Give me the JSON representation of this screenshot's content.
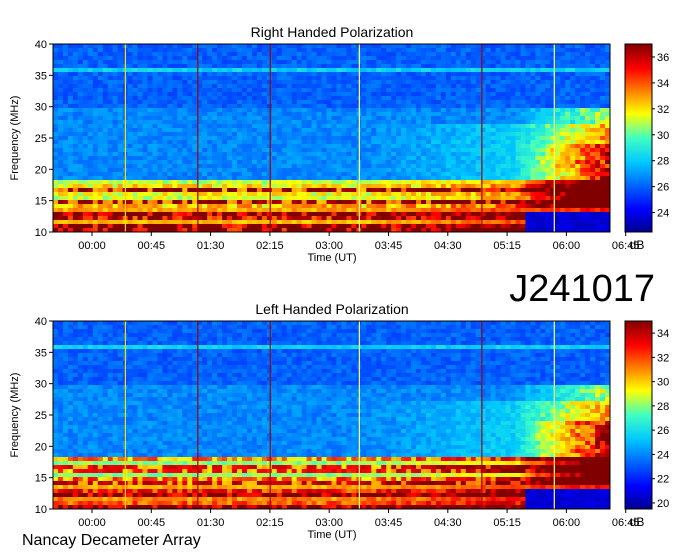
{
  "title_id": "J241017",
  "footer": "Nancay Decameter Array",
  "chart_data": [
    {
      "type": "heatmap",
      "title": "Right Handed Polarization",
      "xlabel": "Time (UT)",
      "ylabel": "Frequency (MHz)",
      "x_tick_labels": [
        "00:00",
        "00:45",
        "01:30",
        "02:15",
        "03:00",
        "03:45",
        "04:30",
        "05:15",
        "06:00",
        "06:45"
      ],
      "y_tick_labels": [
        "10",
        "15",
        "20",
        "25",
        "30",
        "35",
        "40"
      ],
      "ylim": [
        10,
        40
      ],
      "colorbar": {
        "label": "dB",
        "ticks": [
          "24",
          "26",
          "28",
          "30",
          "32",
          "34",
          "36"
        ],
        "range": [
          22.5,
          37
        ]
      }
    },
    {
      "type": "heatmap",
      "title": "Left Handed Polarization",
      "xlabel": "Time (UT)",
      "ylabel": "Frequency (MHz)",
      "x_tick_labels": [
        "00:00",
        "00:45",
        "01:30",
        "02:15",
        "03:00",
        "03:45",
        "04:30",
        "05:15",
        "06:00",
        "06:45"
      ],
      "y_tick_labels": [
        "10",
        "15",
        "20",
        "25",
        "30",
        "35",
        "40"
      ],
      "ylim": [
        10,
        40
      ],
      "colorbar": {
        "label": "dB",
        "ticks": [
          "20",
          "22",
          "24",
          "26",
          "28",
          "30",
          "32",
          "34"
        ],
        "range": [
          19.5,
          35
        ]
      }
    }
  ],
  "colors": {
    "low": "#00008f",
    "mid": "#00bfff",
    "high": "#ffff00",
    "max": "#8b0000"
  }
}
